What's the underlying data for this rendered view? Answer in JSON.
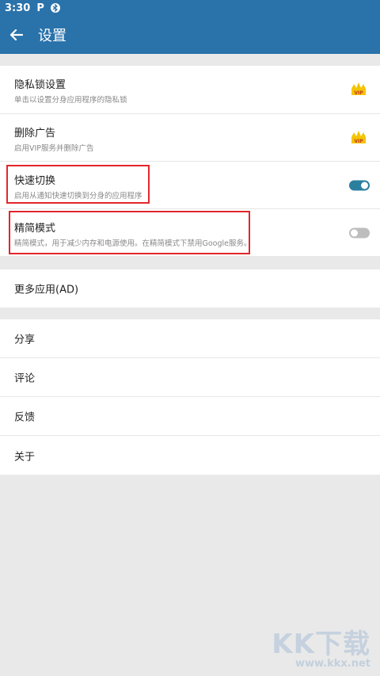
{
  "status": {
    "time": "3:30",
    "p_glyph": "P",
    "bt_glyph": "ʙ"
  },
  "header": {
    "title": "设置"
  },
  "settings": {
    "privacy_lock": {
      "title": "隐私锁设置",
      "subtitle": "单击以设置分身应用程序的隐私锁",
      "badge": "VIP"
    },
    "remove_ads": {
      "title": "删除广告",
      "subtitle": "启用VIP服务并删除广告",
      "badge": "VIP"
    },
    "quick_switch": {
      "title": "快速切换",
      "subtitle": "启用从通知快速切换到分身的应用程序",
      "enabled": true
    },
    "lite_mode": {
      "title": "精简模式",
      "subtitle": "精简模式，用于减少内存和电源使用。在精简模式下禁用Google服务。",
      "enabled": false
    }
  },
  "more_apps": {
    "label": "更多应用(AD)"
  },
  "menu": {
    "share": "分享",
    "review": "评论",
    "feedback": "反馈",
    "about": "关于"
  },
  "watermark": {
    "logo": "KK下载",
    "url": "www.kkx.net"
  },
  "colors": {
    "primary": "#2a72aa",
    "toggle_on": "#2a7f9e",
    "highlight": "#e3262b"
  }
}
